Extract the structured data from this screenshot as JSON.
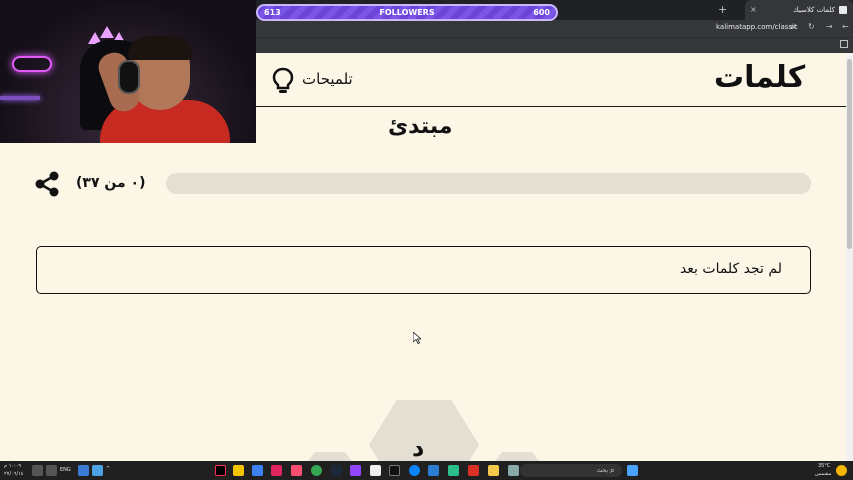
{
  "browser": {
    "tab_title": "كلمات كلاسيك",
    "tab_close": "×",
    "new_tab": "+",
    "url": "kalimatapp.com/classic"
  },
  "overlay": {
    "followers_label": "FOLLOWERS",
    "followers_current": "613",
    "followers_goal": "600"
  },
  "header": {
    "logo": "كلمات",
    "hints_label": "تلميحات"
  },
  "game": {
    "level": "مبتدئ",
    "progress_text": "(٠ من ٣٧)",
    "progress_fraction": 0,
    "found_words_placeholder": "لم تجد كلمات بعد",
    "center_letter": "د"
  },
  "taskbar": {
    "search_placeholder": "بحث",
    "language": "ENG",
    "time": "١٠:٠٩ م",
    "date": "٢٧/٠٦/١٤",
    "weather_temp": "35°C",
    "weather_desc": "مشمس"
  },
  "colors": {
    "page_bg": "#fbf6e6",
    "text": "#111111",
    "track": "#e4dfd0",
    "overlay_purple": "#6a45d8"
  }
}
